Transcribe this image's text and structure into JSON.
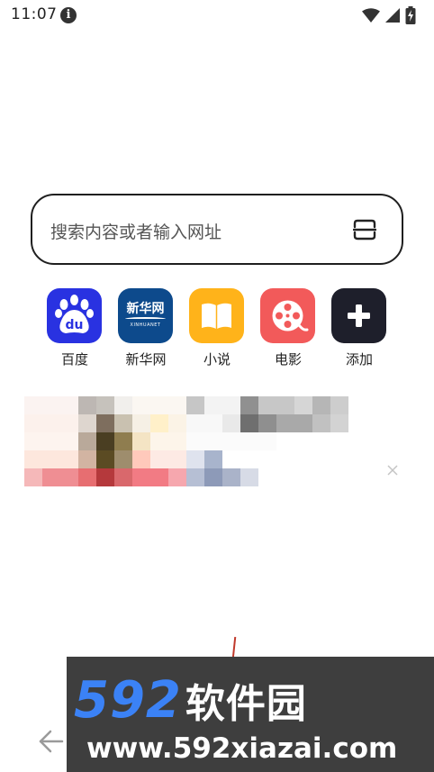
{
  "status_bar": {
    "time": "11:07",
    "info_icon": "info-icon",
    "icons": [
      "wifi-icon",
      "cellular-signal-icon",
      "battery-charging-icon"
    ]
  },
  "search": {
    "placeholder": "搜索内容或者输入网址",
    "scan_icon": "scan-icon"
  },
  "quick_links": [
    {
      "label": "百度",
      "icon": "baidu-icon",
      "color": "#2932e1"
    },
    {
      "label": "新华网",
      "icon": "xinhuanet-icon",
      "color": "#0d4a8c",
      "icon_text": "新华网",
      "icon_subtext": "XINHUANET"
    },
    {
      "label": "小说",
      "icon": "book-icon",
      "color": "#ffb31a"
    },
    {
      "label": "电影",
      "icon": "film-reel-icon",
      "color": "#f25a5a"
    },
    {
      "label": "添加",
      "icon": "plus-icon",
      "color": "#1e1f2b"
    }
  ],
  "card": {
    "close_icon": "close-icon"
  },
  "navigation": {
    "back_icon": "back-arrow-icon"
  },
  "watermark": {
    "number": "592",
    "name": "软件园",
    "url": "www.592xiazai.com"
  }
}
